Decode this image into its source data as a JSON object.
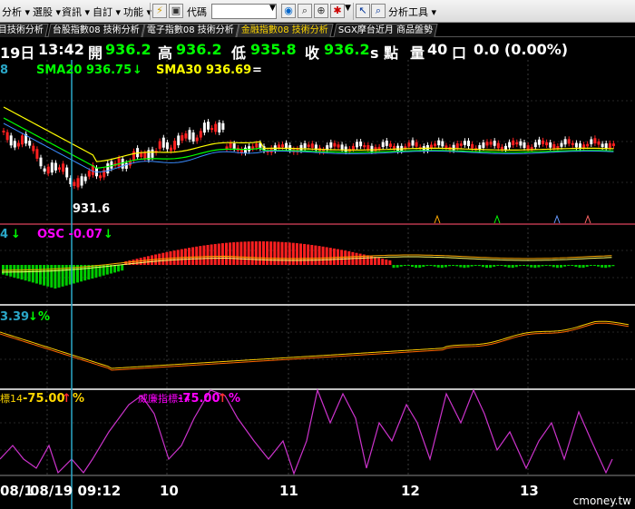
{
  "toolbar": {
    "menus": [
      "分析",
      "選股",
      "資訊",
      "自訂",
      "功能"
    ],
    "code_label": "代碼",
    "code_value": "",
    "analysis_tools": "分析工具"
  },
  "tabs": [
    "目技術分析",
    "台股指數08 技術分析",
    "電子指數08 技術分析",
    "金融指數08 技術分析",
    "SGX摩台近月 商品盤勢"
  ],
  "active_tab": 3,
  "quote": {
    "date": "19日",
    "time": "13:42",
    "open_label": "開",
    "open": "936.2",
    "high_label": "高",
    "high": "936.2",
    "low_label": "低",
    "low": "935.8",
    "close_label": "收",
    "close": "936.2",
    "unit": "s 點",
    "volume_label": "量",
    "volume": "40",
    "volume_unit": "口",
    "change": "0.0 (0.00%)"
  },
  "legends": {
    "price_prefix": "8",
    "sma20": "SMA20 936.75",
    "sma30": "SMA30 936.69",
    "macd_prefix": "4",
    "osc": "OSC -0.07",
    "kd_prefix": "3.39",
    "kd_suffix": "%",
    "wr_prefix": "標14",
    "wr_value": "-75.00",
    "wr_suffix": "%",
    "wr_name": "威廉指標14",
    "wr_value2": "-75.00",
    "wr_suffix2": "%"
  },
  "low_marker": "931.6",
  "x_axis": {
    "date1": "08/1",
    "cursor_time": "08/19 09:12",
    "ticks": [
      "10",
      "11",
      "12",
      "13"
    ]
  },
  "colors": {
    "sma20": "#00ff00",
    "sma30": "#ffff00",
    "osc": "#ff00ff",
    "up": "#ff2020",
    "down": "#00cc00",
    "cursor": "#2aa7c8",
    "wr_line": "#cc33cc"
  },
  "logo": "cmoney.tw"
}
